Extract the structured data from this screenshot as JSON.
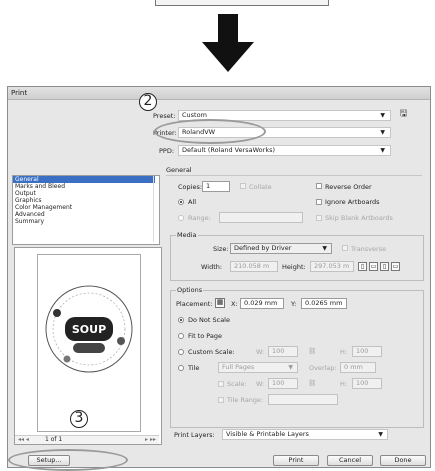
{
  "dialog": {
    "title": "Print"
  },
  "top": {
    "preset_label": "Preset:",
    "preset_value": "Custom",
    "printer_label": "Printer:",
    "printer_value": "RolandVW",
    "ppd_label": "PPD:",
    "ppd_value": "Default (Roland VersaWorks)"
  },
  "sidebar": {
    "items": [
      "General",
      "Marks and Bleed",
      "Output",
      "Graphics",
      "Color Management",
      "Advanced",
      "Summary"
    ]
  },
  "general": {
    "title": "General",
    "copies_label": "Copies:",
    "copies_value": "1",
    "collate_label": "Collate",
    "reverse_label": "Reverse Order",
    "all_label": "All",
    "ignore_label": "Ignore Artboards",
    "range_label": "Range:",
    "skip_label": "Skip Blank Artboards"
  },
  "media": {
    "title": "Media",
    "size_label": "Size:",
    "size_value": "Defined by Driver",
    "transverse_label": "Transverse",
    "width_label": "Width:",
    "width_value": "210.058 m",
    "height_label": "Height:",
    "height_value": "297.053 m"
  },
  "options": {
    "title": "Options",
    "placement_label": "Placement:",
    "x_label": "X:",
    "x_value": "0.029 mm",
    "y_label": "Y:",
    "y_value": "0.0265 mm",
    "donot_label": "Do Not Scale",
    "fit_label": "Fit to Page",
    "custom_label": "Custom Scale:",
    "w_label": "W:",
    "w_value": "100",
    "h_label": "H:",
    "h_value": "100",
    "tile_label": "Tile",
    "tile_select": "Full Pages",
    "overlap_label": "Overlap:",
    "overlap_value": "0 mm",
    "scale_label": "Scale:",
    "sw_label": "W:",
    "sw_value": "100",
    "sh_label": "H:",
    "sh_value": "100",
    "tilerange_label": "Tile Range:"
  },
  "print_layers": {
    "label": "Print Layers:",
    "value": "Visible & Printable Layers"
  },
  "buttons": {
    "setup": "Setup...",
    "print": "Print",
    "cancel": "Cancel",
    "done": "Done"
  },
  "preview": {
    "nav_label": "1 of 1",
    "logo_text": "SOUP"
  },
  "callouts": {
    "two": "2",
    "three": "3"
  }
}
